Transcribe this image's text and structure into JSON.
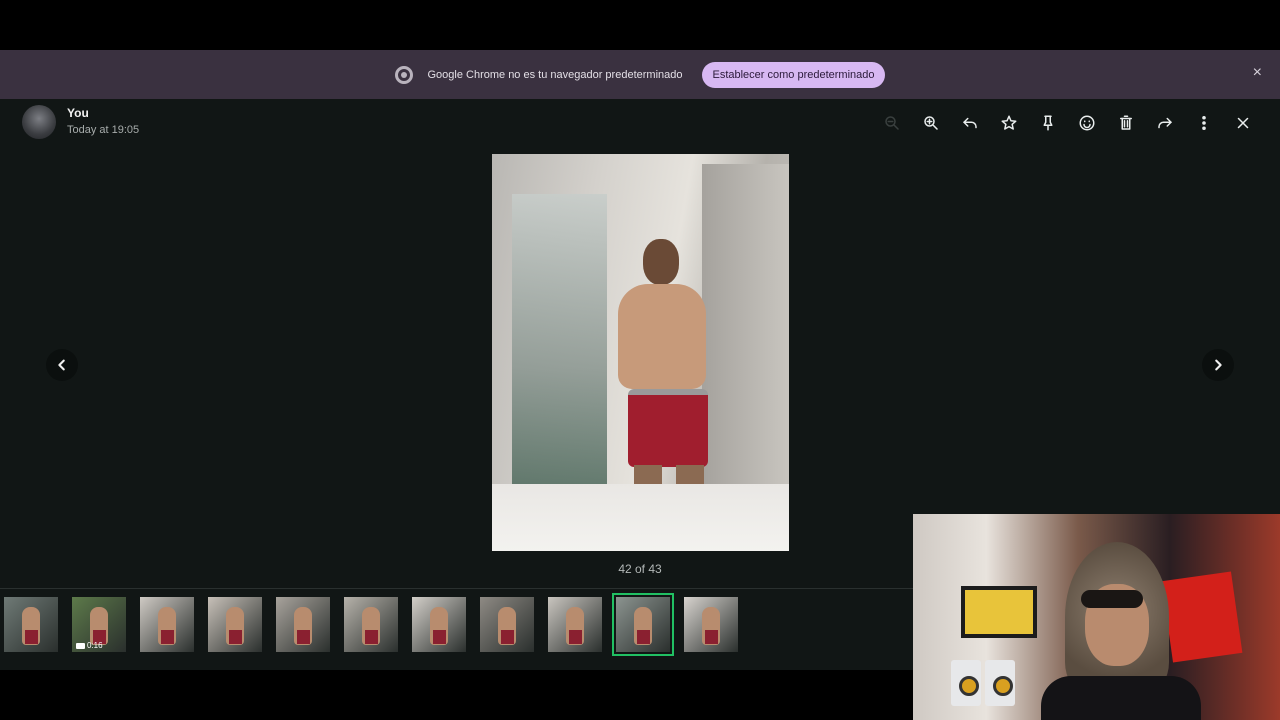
{
  "infobar": {
    "message": "Google Chrome no es tu navegador predeterminado",
    "button_label": "Establecer como predeterminado",
    "close_glyph": "×"
  },
  "viewer": {
    "sender": "You",
    "timestamp": "Today at 19:05",
    "counter": "42 of 43",
    "toolbar": [
      "zoom-out-icon",
      "zoom-in-icon",
      "reply-icon",
      "star-icon",
      "pin-icon",
      "emoji-icon",
      "delete-icon",
      "forward-icon",
      "more-options-icon",
      "close-icon"
    ],
    "thumbnails": [
      {
        "kind": "image"
      },
      {
        "kind": "video",
        "duration": "0:16"
      },
      {
        "kind": "image"
      },
      {
        "kind": "image"
      },
      {
        "kind": "image"
      },
      {
        "kind": "image"
      },
      {
        "kind": "image"
      },
      {
        "kind": "image"
      },
      {
        "kind": "image"
      },
      {
        "kind": "image",
        "selected": true
      },
      {
        "kind": "image"
      }
    ]
  },
  "colors": {
    "infobar_bg": "#3a3140",
    "infobar_button": "#d7b8f2",
    "viewer_bg": "#111615",
    "selected_outline": "#21c063",
    "shorts": "#a01e2e"
  }
}
